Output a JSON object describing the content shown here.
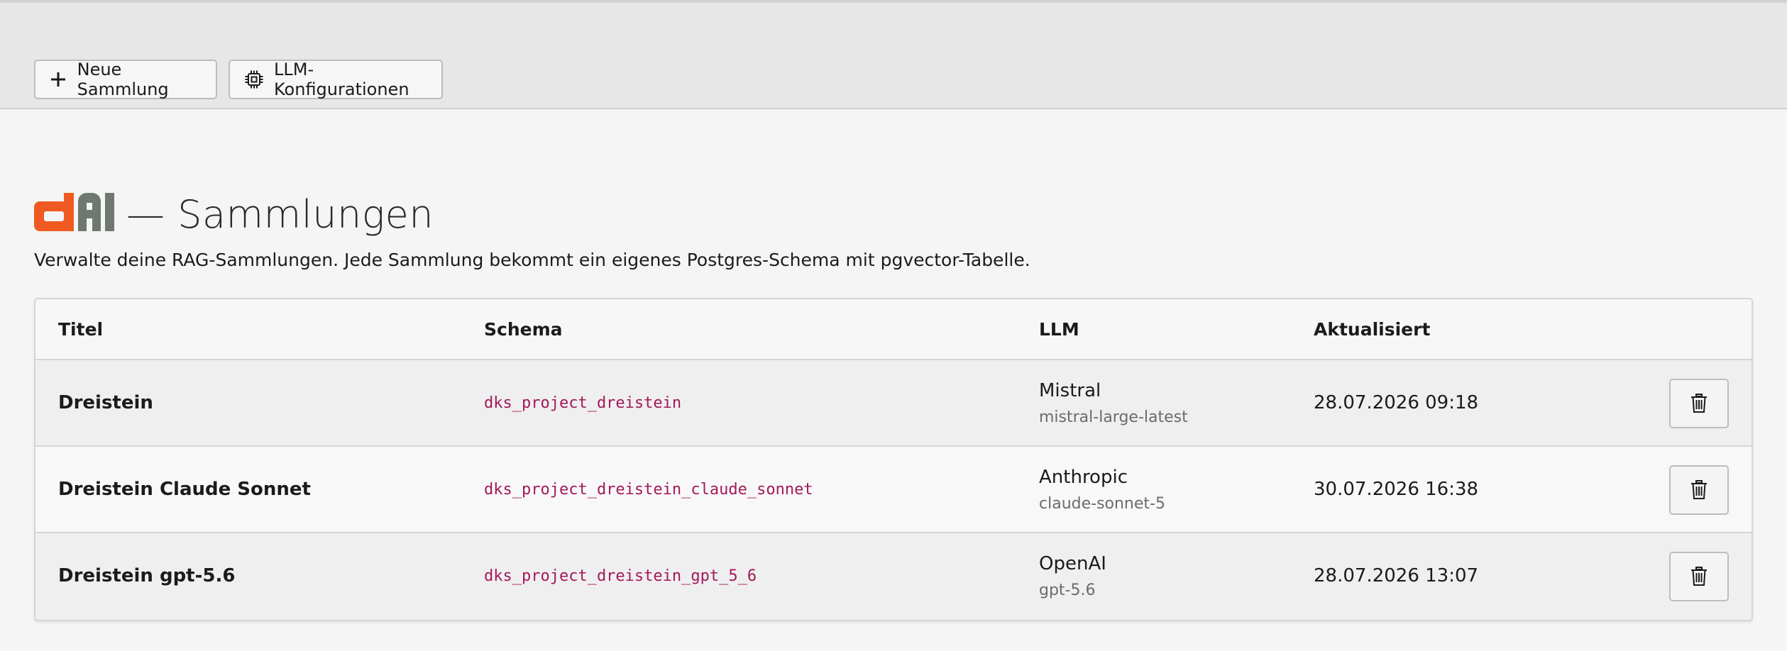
{
  "toolbar": {
    "new_collection_label": "Neue Sammlung",
    "llm_configs_label": "LLM-Konfigurationen"
  },
  "header": {
    "logo_text": "dAI",
    "logo_colors": {
      "d": "#f05a22",
      "AI": "#6f7771"
    },
    "title": "— Sammlungen",
    "description": "Verwalte deine RAG-Sammlungen. Jede Sammlung bekommt ein eigenes Postgres-Schema mit pgvector-Tabelle."
  },
  "table": {
    "columns": [
      "Titel",
      "Schema",
      "LLM",
      "Aktualisiert"
    ],
    "rows": [
      {
        "title": "Dreistein",
        "schema": "dks_project_dreistein",
        "provider": "Mistral",
        "model": "mistral-large-latest",
        "updated": "28.07.2026 09:18"
      },
      {
        "title": "Dreistein Claude Sonnet",
        "schema": "dks_project_dreistein_claude_sonnet",
        "provider": "Anthropic",
        "model": "claude-sonnet-5",
        "updated": "30.07.2026 16:38"
      },
      {
        "title": "Dreistein gpt-5.6",
        "schema": "dks_project_dreistein_gpt_5_6",
        "provider": "OpenAI",
        "model": "gpt-5.6",
        "updated": "28.07.2026 13:07"
      }
    ]
  },
  "icons": {
    "new_collection": "plus-icon",
    "llm_configs": "chip-icon",
    "delete": "trash-icon"
  },
  "colors": {
    "schema_text": "#a3195b",
    "toolbar_bg": "#e7e7e7",
    "page_bg": "#f5f5f5"
  }
}
